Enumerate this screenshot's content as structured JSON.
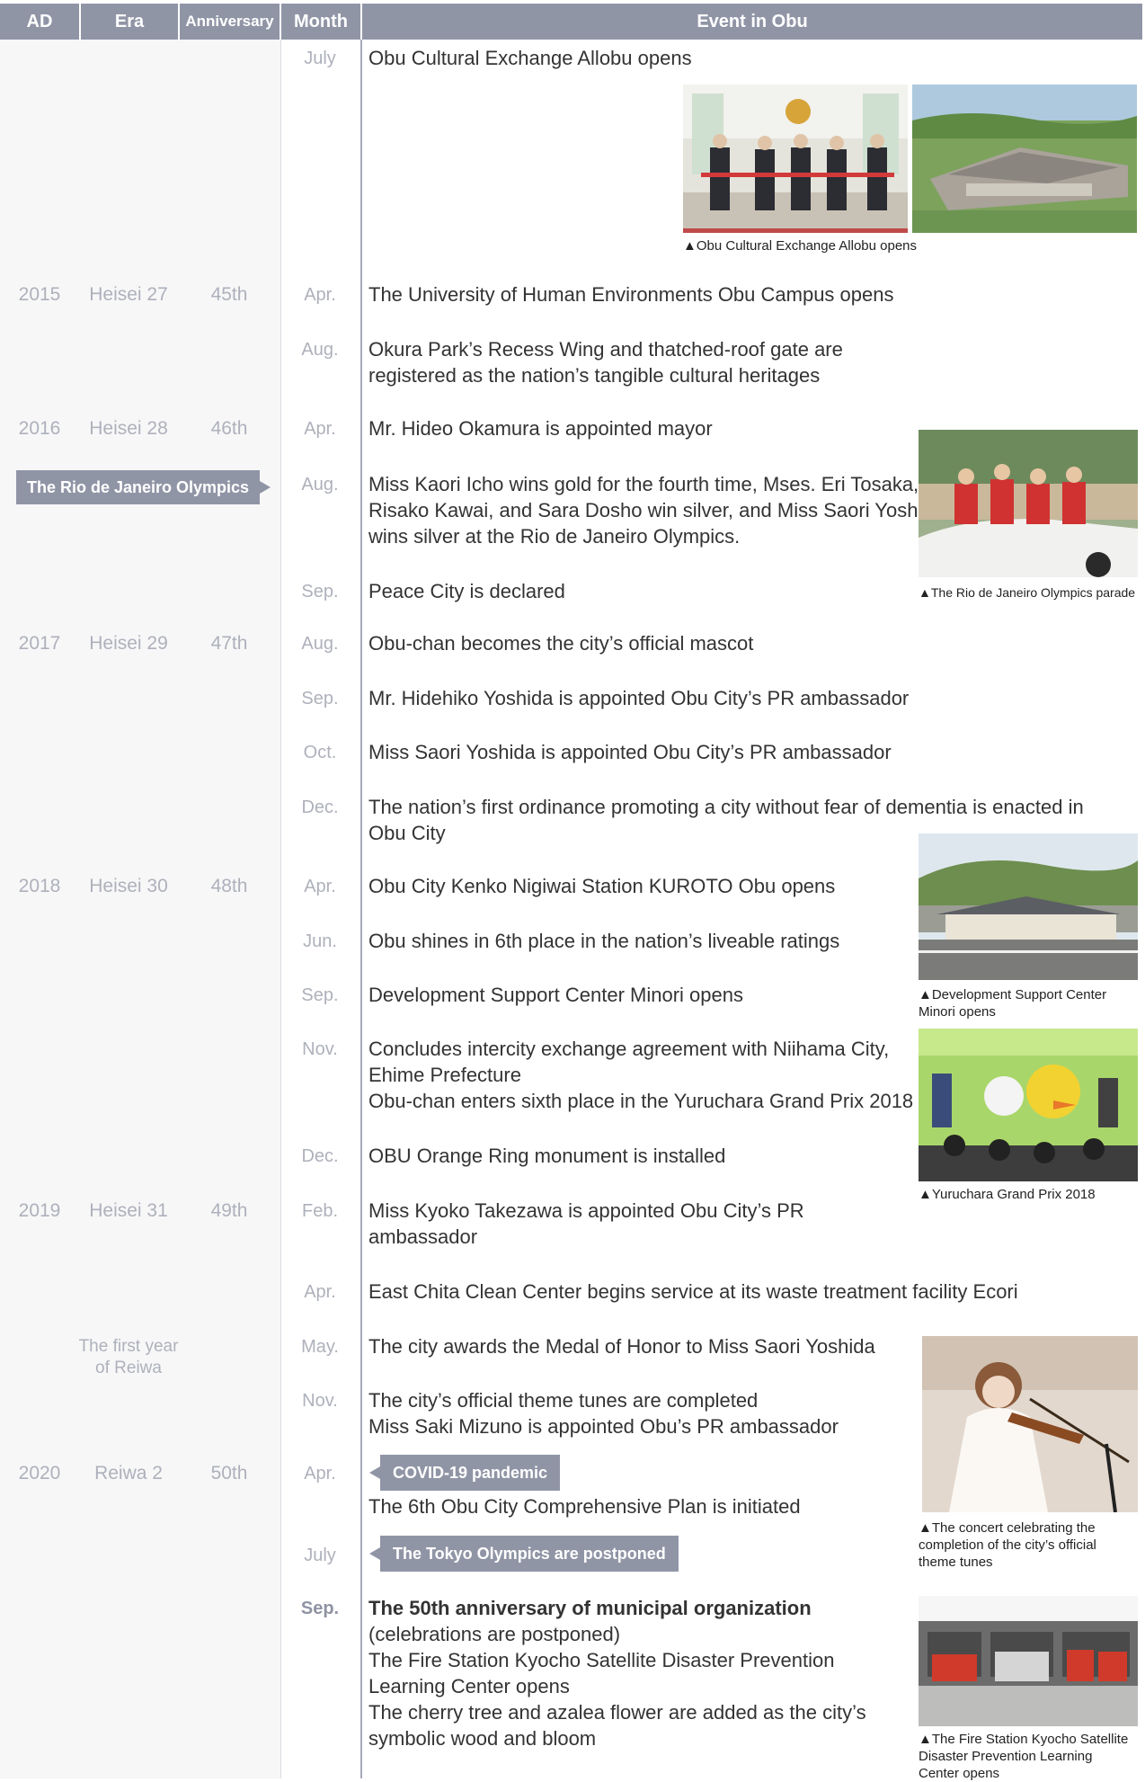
{
  "header": {
    "ad": "AD",
    "era": "Era",
    "anniversary": "Anniversary",
    "month": "Month",
    "event": "Event in Obu"
  },
  "years": {
    "y2015": {
      "ad": "2015",
      "era": "Heisei 27",
      "ann": "45th"
    },
    "y2016": {
      "ad": "2016",
      "era": "Heisei 28",
      "ann": "46th"
    },
    "y2017": {
      "ad": "2017",
      "era": "Heisei 29",
      "ann": "47th"
    },
    "y2018": {
      "ad": "2018",
      "era": "Heisei 30",
      "ann": "48th"
    },
    "y2019": {
      "ad": "2019",
      "era": "Heisei 31",
      "ann": "49th"
    },
    "reiwa1": "The first year\nof Reiwa",
    "y2020": {
      "ad": "2020",
      "era": "Reiwa 2",
      "ann": "50th"
    }
  },
  "events": {
    "e01": {
      "month": "July",
      "text": "Obu Cultural Exchange Allobu opens"
    },
    "e02": {
      "month": "Apr.",
      "text": "The University of Human Environments Obu Campus opens"
    },
    "e03": {
      "month": "Aug.",
      "text": "Okura Park’s Recess Wing and thatched-roof gate are\nregistered as the nation’s tangible cultural heritages"
    },
    "e04": {
      "month": "Apr.",
      "text": "Mr. Hideo Okamura is appointed mayor"
    },
    "e05": {
      "month": "Aug.",
      "text": "Miss Kaori Icho wins gold for the fourth time, Mses. Eri Tosaka,\nRisako Kawai, and Sara Dosho win silver, and Miss Saori Yoshida\nwins silver at the Rio de Janeiro Olympics."
    },
    "e06": {
      "month": "Sep.",
      "text": "Peace City is declared"
    },
    "e07": {
      "month": "Aug.",
      "text": "Obu-chan becomes the city’s official mascot"
    },
    "e08": {
      "month": "Sep.",
      "text": "Mr. Hidehiko Yoshida is appointed Obu City’s PR ambassador"
    },
    "e09": {
      "month": "Oct.",
      "text": "Miss Saori Yoshida is appointed Obu City’s PR ambassador"
    },
    "e10": {
      "month": "Dec.",
      "text": "The nation’s first ordinance promoting a city without fear of dementia is enacted in\nObu City"
    },
    "e11": {
      "month": "Apr.",
      "text": "Obu City Kenko Nigiwai Station KUROTO Obu opens"
    },
    "e12": {
      "month": "Jun.",
      "text": "Obu shines in 6th place in the nation’s liveable ratings"
    },
    "e13": {
      "month": "Sep.",
      "text": "Development Support Center Minori opens"
    },
    "e14": {
      "month": "Nov.",
      "text": "Concludes intercity exchange agreement with Niihama City,\nEhime Prefecture\nObu-chan enters sixth place in the Yuruchara Grand Prix 2018"
    },
    "e15": {
      "month": "Dec.",
      "text": "OBU Orange Ring monument is installed"
    },
    "e16": {
      "month": "Feb.",
      "text": "Miss Kyoko Takezawa is appointed Obu City’s PR\nambassador"
    },
    "e17": {
      "month": "Apr.",
      "text": "East Chita Clean Center begins service at its waste treatment facility Ecori"
    },
    "e18": {
      "month": "May.",
      "text": "The city awards the Medal of Honor to Miss Saori Yoshida"
    },
    "e19": {
      "month": "Nov.",
      "text": "The city’s official theme tunes are completed\nMiss Saki Mizuno is appointed Obu’s PR ambassador"
    },
    "e20": {
      "month": "Apr.",
      "text": "The 6th Obu City Comprehensive Plan is initiated"
    },
    "e21": {
      "month": "July"
    },
    "e22": {
      "month": "Sep.",
      "title": "The 50th anniversary of municipal organization",
      "text": "(celebrations are postponed)\nThe Fire Station Kyocho Satellite Disaster Prevention\nLearning Center opens\nThe cherry tree and azalea flower are added as the city’s\nsymbolic wood and bloom"
    }
  },
  "tags": {
    "rio": "The Rio de Janeiro Olympics",
    "covid": "COVID-19 pandemic",
    "tokyo": "The Tokyo Olympics are postponed"
  },
  "captions": {
    "allobu": "▲Obu Cultural Exchange Allobu opens",
    "rio": "▲The Rio de Janeiro Olympics parade",
    "minori": "▲Development Support Center\n   Minori opens",
    "yuru": "▲Yuruchara Grand Prix 2018",
    "concert": "▲The concert celebrating the\n   completion of the city’s official\n   theme tunes",
    "fire": "▲The Fire Station Kyocho Satellite\n   Disaster Prevention Learning\n   Center opens"
  },
  "colors": {
    "header_bg": "#9095a6",
    "left_bg": "#f7f7f8",
    "muted_text": "#aeb1bb",
    "body_text": "#333333"
  }
}
